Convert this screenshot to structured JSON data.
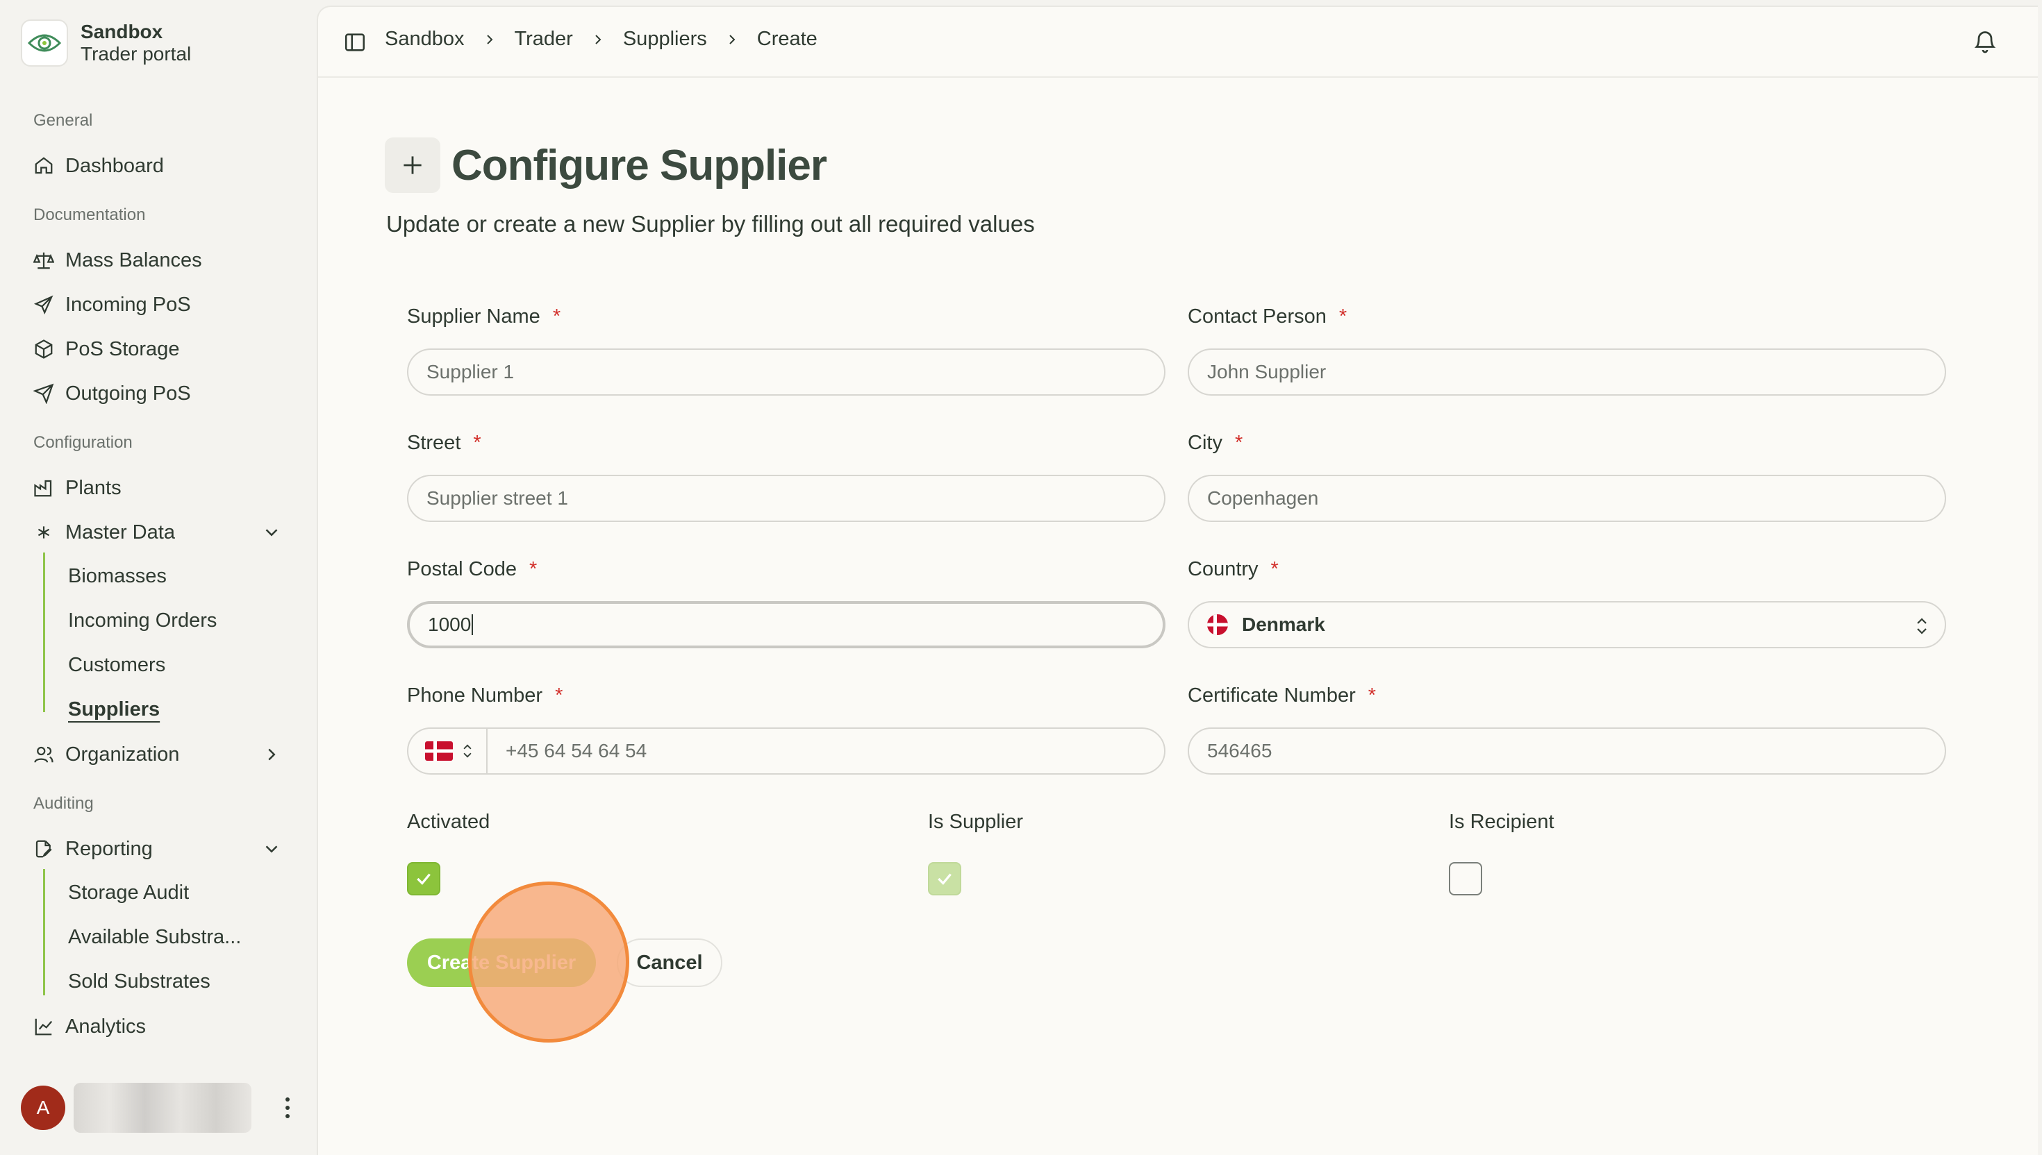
{
  "brand": {
    "name": "Sandbox",
    "subtitle": "Trader portal"
  },
  "sidebar": {
    "sections": {
      "general": "General",
      "documentation": "Documentation",
      "configuration": "Configuration",
      "auditing": "Auditing"
    },
    "items": {
      "dashboard": "Dashboard",
      "mass_balances": "Mass Balances",
      "incoming_pos": "Incoming PoS",
      "pos_storage": "PoS Storage",
      "outgoing_pos": "Outgoing PoS",
      "plants": "Plants",
      "master_data": "Master Data",
      "organization": "Organization",
      "reporting": "Reporting",
      "analytics": "Analytics"
    },
    "master_data_children": [
      "Biomasses",
      "Incoming Orders",
      "Customers",
      "Suppliers"
    ],
    "reporting_children": [
      "Storage Audit",
      "Available Substra...",
      "Sold Substrates"
    ],
    "active_item": "Suppliers",
    "user_initial": "A"
  },
  "breadcrumb": [
    "Sandbox",
    "Trader",
    "Suppliers",
    "Create"
  ],
  "page": {
    "title": "Configure Supplier",
    "subtitle": "Update or create a new Supplier by filling out all required values"
  },
  "form": {
    "required_mark": "*",
    "supplier_name": {
      "label": "Supplier Name",
      "placeholder": "Supplier 1"
    },
    "contact_person": {
      "label": "Contact Person",
      "placeholder": "John Supplier"
    },
    "street": {
      "label": "Street",
      "placeholder": "Supplier street 1"
    },
    "city": {
      "label": "City",
      "placeholder": "Copenhagen"
    },
    "postal_code": {
      "label": "Postal Code",
      "value": "1000"
    },
    "country": {
      "label": "Country",
      "value": "Denmark"
    },
    "phone_number": {
      "label": "Phone Number",
      "placeholder": "+45 64 54 64 54"
    },
    "certificate_number": {
      "label": "Certificate Number",
      "placeholder": "546465"
    },
    "activated": {
      "label": "Activated",
      "checked": true
    },
    "is_supplier": {
      "label": "Is Supplier",
      "checked": true,
      "disabled": true
    },
    "is_recipient": {
      "label": "Is Recipient",
      "checked": false
    },
    "submit_label": "Create Supplier",
    "cancel_label": "Cancel"
  },
  "colors": {
    "accent_green": "#8cc43c",
    "required_red": "#d2302b",
    "click_indicator": "#f28a3c",
    "avatar": "#a12b1a"
  }
}
